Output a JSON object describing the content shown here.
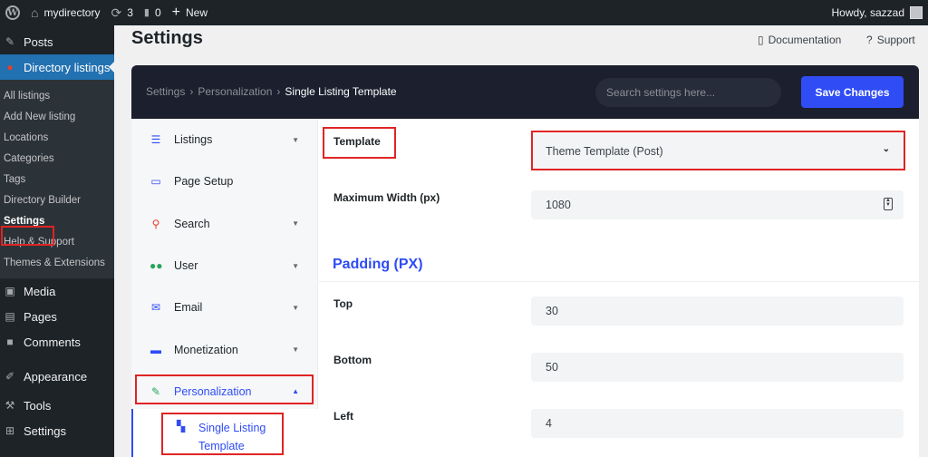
{
  "adminbar": {
    "site_name": "mydirectory",
    "updates_count": "3",
    "comments_count": "0",
    "new_label": "New",
    "howdy": "Howdy, sazzad"
  },
  "sidebar": {
    "top_items": [
      {
        "label": "Posts",
        "icon": "pin-icon"
      },
      {
        "label": "Directory listings",
        "icon": "directory-icon"
      }
    ],
    "submenu": [
      "All listings",
      "Add New listing",
      "Locations",
      "Categories",
      "Tags",
      "Directory Builder",
      "Settings",
      "Help & Support",
      "Themes & Extensions"
    ],
    "bottom_items": [
      {
        "label": "Media",
        "icon": "media-icon"
      },
      {
        "label": "Pages",
        "icon": "pages-icon"
      },
      {
        "label": "Comments",
        "icon": "comments-icon"
      },
      {
        "label": "Appearance",
        "icon": "appearance-icon"
      },
      {
        "label": "Tools",
        "icon": "tools-icon"
      },
      {
        "label": "Settings",
        "icon": "settings-icon"
      }
    ]
  },
  "header": {
    "title": "Settings",
    "documentation": "Documentation",
    "support": "Support"
  },
  "panel": {
    "breadcrumb": [
      "Settings",
      "Personalization",
      "Single Listing Template"
    ],
    "search_placeholder": "Search settings here...",
    "save_label": "Save Changes"
  },
  "settings_nav": {
    "items": [
      {
        "label": "Listings",
        "icon": "list-icon",
        "icon_color": "#2f4cf5"
      },
      {
        "label": "Page Setup",
        "icon": "monitor-icon",
        "icon_color": "#2f4cf5"
      },
      {
        "label": "Search",
        "icon": "search-icon",
        "icon_color": "#e0412e"
      },
      {
        "label": "User",
        "icon": "users-icon",
        "icon_color": "#27a55a"
      },
      {
        "label": "Email",
        "icon": "envelope-icon",
        "icon_color": "#2f4cf5"
      },
      {
        "label": "Monetization",
        "icon": "card-icon",
        "icon_color": "#2f4cf5"
      },
      {
        "label": "Personalization",
        "icon": "brush-icon",
        "icon_color": "#27a55a"
      }
    ],
    "sub_item": "Single Listing Template"
  },
  "form": {
    "template_label": "Template",
    "template_value": "Theme Template (Post)",
    "max_width_label": "Maximum Width (px)",
    "max_width_value": "1080",
    "padding_heading": "Padding (PX)",
    "top_label": "Top",
    "top_value": "30",
    "bottom_label": "Bottom",
    "bottom_value": "50",
    "left_label": "Left",
    "left_value": "4"
  },
  "colors": {
    "accent": "#2f4cf5",
    "wp_blue": "#2271b1",
    "highlight": "#e02424",
    "panel_dark": "#1b1f2e"
  }
}
